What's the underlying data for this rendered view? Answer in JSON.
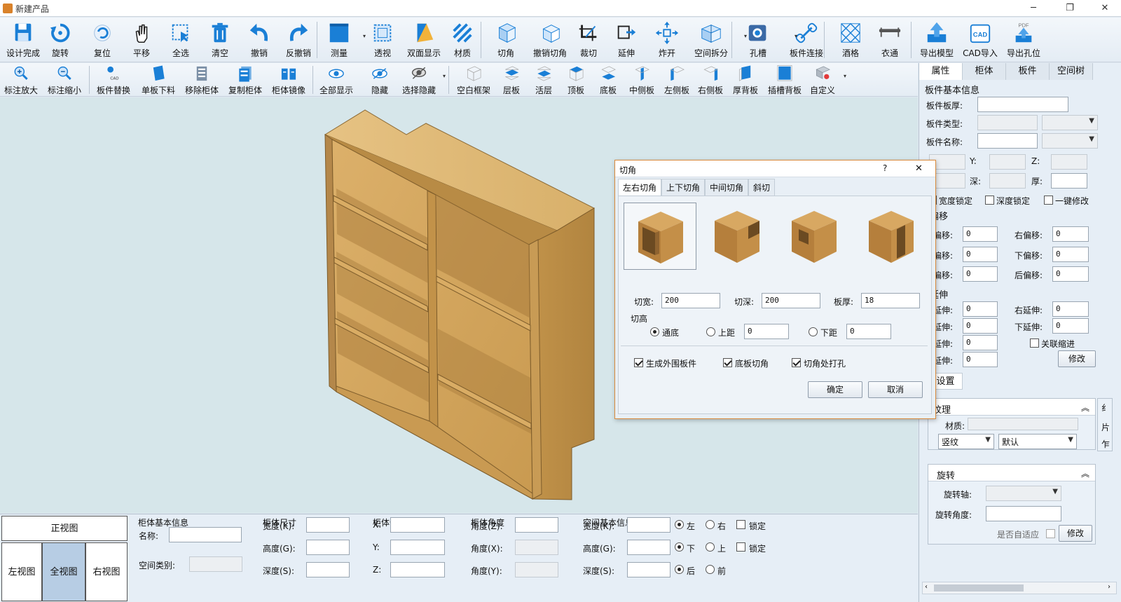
{
  "window": {
    "title": "新建产品",
    "min": "─",
    "max": "❐",
    "close": "✕"
  },
  "toolbar1": [
    {
      "label": "设计完成",
      "icon": "save-icon"
    },
    {
      "label": "旋转",
      "icon": "rotate-icon"
    },
    {
      "label": "复位",
      "icon": "reset-icon"
    },
    {
      "label": "平移",
      "icon": "hand-pan-icon"
    },
    {
      "label": "全选",
      "icon": "select-all-icon"
    },
    {
      "label": "清空",
      "icon": "trash-icon"
    },
    {
      "label": "撤销",
      "icon": "undo-icon"
    },
    {
      "label": "反撤销",
      "icon": "redo-icon"
    },
    {
      "label": "测量",
      "icon": "measure-icon"
    },
    {
      "label": "透视",
      "icon": "perspective-icon"
    },
    {
      "label": "双面显示",
      "icon": "double-side-icon"
    },
    {
      "label": "材质",
      "icon": "material-icon"
    },
    {
      "label": "切角",
      "icon": "cut-corner-icon"
    },
    {
      "label": "撤销切角",
      "icon": "undo-cut-corner-icon"
    },
    {
      "label": "裁切",
      "icon": "crop-icon"
    },
    {
      "label": "延伸",
      "icon": "extend-icon"
    },
    {
      "label": "炸开",
      "icon": "explode-icon"
    },
    {
      "label": "空间拆分",
      "icon": "space-split-icon"
    },
    {
      "label": "孔槽",
      "icon": "hole-slot-icon"
    },
    {
      "label": "板件连接",
      "icon": "panel-connect-icon"
    },
    {
      "label": "酒格",
      "icon": "wine-rack-icon"
    },
    {
      "label": "衣通",
      "icon": "clothes-rail-icon"
    },
    {
      "label": "导出模型",
      "icon": "export-model-icon"
    },
    {
      "label": "CAD导入",
      "icon": "cad-import-icon"
    },
    {
      "label": "导出孔位",
      "icon": "export-holes-pdf-icon"
    }
  ],
  "toolbar2": [
    {
      "label": "标注放大",
      "icon": "zoom-in-dim-icon"
    },
    {
      "label": "标注缩小",
      "icon": "zoom-out-dim-icon"
    },
    {
      "label": "板件替换",
      "icon": "panel-replace-icon"
    },
    {
      "label": "单板下料",
      "icon": "single-panel-cut-icon"
    },
    {
      "label": "移除柜体",
      "icon": "remove-cabinet-icon"
    },
    {
      "label": "复制柜体",
      "icon": "copy-cabinet-icon"
    },
    {
      "label": "柜体镜像",
      "icon": "mirror-cabinet-icon"
    },
    {
      "label": "全部显示",
      "icon": "show-all-eye-icon"
    },
    {
      "label": "隐藏",
      "icon": "hide-eye-icon"
    },
    {
      "label": "选择隐藏",
      "icon": "select-hide-icon"
    },
    {
      "label": "空白框架",
      "icon": "blank-frame-icon"
    },
    {
      "label": "层板",
      "icon": "shelf-icon"
    },
    {
      "label": "活层",
      "icon": "movable-shelf-icon"
    },
    {
      "label": "顶板",
      "icon": "top-panel-icon"
    },
    {
      "label": "底板",
      "icon": "bottom-panel-icon"
    },
    {
      "label": "中侧板",
      "icon": "middle-side-panel-icon"
    },
    {
      "label": "左侧板",
      "icon": "left-side-panel-icon"
    },
    {
      "label": "右侧板",
      "icon": "right-side-panel-icon"
    },
    {
      "label": "厚背板",
      "icon": "thick-back-panel-icon"
    },
    {
      "label": "插槽背板",
      "icon": "slot-back-panel-icon"
    },
    {
      "label": "自定义",
      "icon": "custom-icon"
    }
  ],
  "views": {
    "front": "正视图",
    "left": "左视图",
    "full": "全视图",
    "right": "右视图"
  },
  "bottom": {
    "cab_info_title": "柜体基本信息",
    "name_label": "名称:",
    "space_type_label": "空间类别:",
    "size_title": "柜体尺寸",
    "width_k": "宽度(K):",
    "height_g": "高度(G):",
    "depth_s": "深度(S):",
    "pos_title": "柜体位置",
    "x": "X:",
    "y": "Y:",
    "z": "Z:",
    "angle_title": "柜体角度",
    "angle_z": "角度(Z):",
    "angle_x": "角度(X):",
    "angle_y": "角度(Y):",
    "space_title": "空间基本信息",
    "left": "左",
    "right": "右",
    "down": "下",
    "up": "上",
    "back": "后",
    "front": "前",
    "lock": "锁定"
  },
  "right_panel": {
    "tabs": [
      "属性",
      "柜体",
      "板件",
      "空间树"
    ],
    "section_title": "板件基本信息",
    "thickness_label": "板件板厚:",
    "type_label": "板件类型:",
    "name_label": "板件名称:",
    "y_label": "Y:",
    "z_label": "Z:",
    "depth_label": "深:",
    "thick_label": "厚:",
    "width_lock": "宽度锁定",
    "depth_lock": "深度锁定",
    "one_key": "一键修改",
    "offset_title": "件偏移",
    "left_off": "左偏移:",
    "right_off": "右偏移:",
    "up_off": "上偏移:",
    "down_off": "下偏移:",
    "front_off": "前偏移:",
    "back_off": "后偏移:",
    "offset_values": [
      "0",
      "0",
      "0",
      "0",
      "0",
      "0"
    ],
    "ext_title": "件延伸",
    "left_ext": "左延伸:",
    "right_ext": "右延伸:",
    "up_ext": "上延伸:",
    "down_ext": "下延伸:",
    "front_ext": "前延伸:",
    "back_ext": "后延伸:",
    "ext_values": [
      "0",
      "0",
      "0",
      "0",
      "0",
      "0"
    ],
    "linked_shrink": "关联缩进",
    "modify": "修改",
    "settings_tab": "件设置",
    "texture_title": "纹理",
    "material_label": "材质:",
    "grain_value": "竖纹",
    "default_value": "默认",
    "rotate_title": "旋转",
    "axis_label": "旋转轴:",
    "angle_label": "旋转角度:",
    "adaptive_label": "是否自适应",
    "modify2": "修改",
    "side_panel_chars": [
      "纟",
      "片",
      "乍"
    ]
  },
  "dialog": {
    "title": "切角",
    "help": "?",
    "close": "✕",
    "tabs": [
      "左右切角",
      "上下切角",
      "中间切角",
      "斜切"
    ],
    "cut_width_label": "切宽:",
    "cut_width": "200",
    "cut_depth_label": "切深:",
    "cut_depth": "200",
    "panel_thick_label": "板厚:",
    "panel_thick": "18",
    "cut_height_label": "切高",
    "through_bottom": "通底",
    "top_dist": "上距",
    "top_dist_value": "0",
    "bottom_dist": "下距",
    "bottom_dist_value": "0",
    "gen_outer": "生成外围板件",
    "bottom_cut": "底板切角",
    "cut_hole": "切角处打孔",
    "ok": "确定",
    "cancel": "取消"
  },
  "colors": {
    "accent": "#1a7fd6",
    "wood": "#d4a75c",
    "dialog_border": "#d98a3c"
  }
}
